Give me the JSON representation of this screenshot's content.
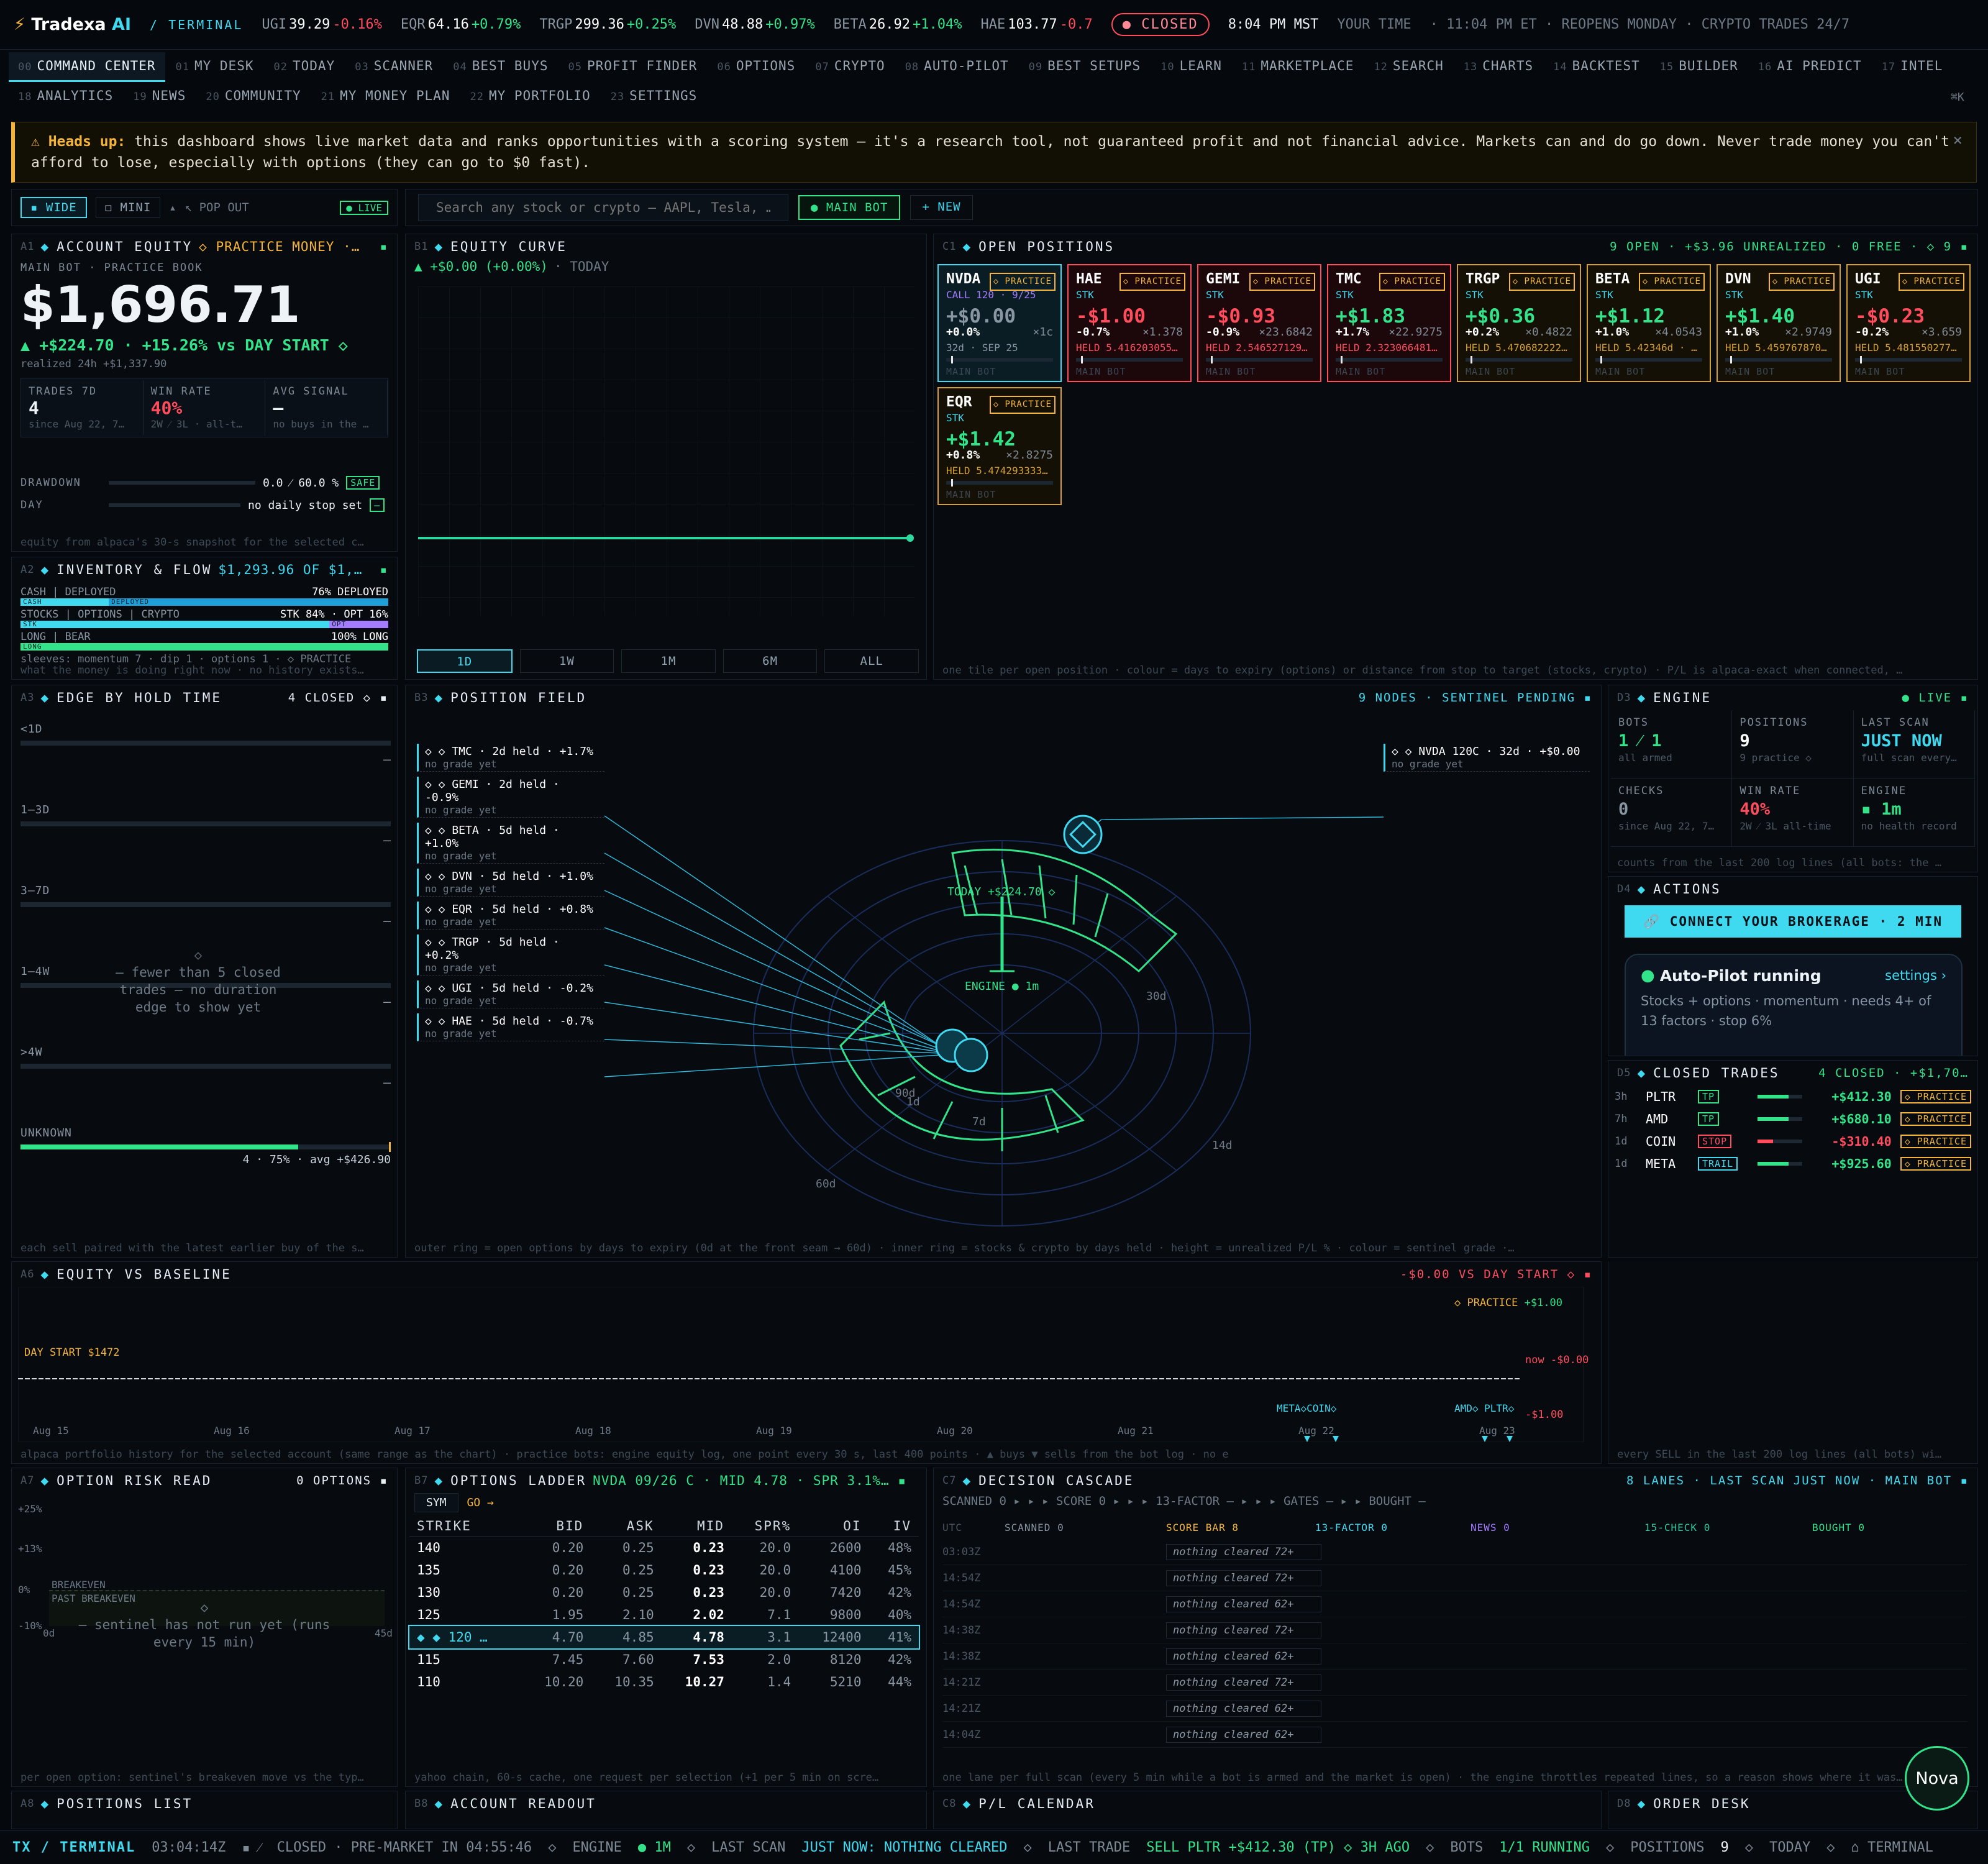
{
  "ticker": {
    "logo": "Tradexa",
    "logo_ai": "AI",
    "sub": "/ TERMINAL",
    "items": [
      {
        "s": "UGI",
        "p": "39.29",
        "c": "-0.16%",
        "up": false
      },
      {
        "s": "EQR",
        "p": "64.16",
        "c": "+0.79%",
        "up": true
      },
      {
        "s": "TRGP",
        "p": "299.36",
        "c": "+0.25%",
        "up": true
      },
      {
        "s": "DVN",
        "p": "48.88",
        "c": "+0.97%",
        "up": true
      },
      {
        "s": "BETA",
        "p": "26.92",
        "c": "+1.04%",
        "up": true
      },
      {
        "s": "HAE",
        "p": "103.77",
        "c": "-0.7",
        "up": false
      }
    ],
    "market": "CLOSED",
    "time": "8:04 PM MST",
    "your": "YOUR TIME",
    "et": "· 11:04 PM ET · REOPENS MONDAY · CRYPTO TRADES 24/7"
  },
  "nav": [
    [
      "00",
      "COMMAND CENTER"
    ],
    [
      "01",
      "MY DESK"
    ],
    [
      "02",
      "TODAY"
    ],
    [
      "03",
      "SCANNER"
    ],
    [
      "04",
      "BEST BUYS"
    ],
    [
      "05",
      "PROFIT FINDER"
    ],
    [
      "06",
      "OPTIONS"
    ],
    [
      "07",
      "CRYPTO"
    ],
    [
      "08",
      "AUTO-PILOT"
    ],
    [
      "09",
      "BEST SETUPS"
    ],
    [
      "10",
      "LEARN"
    ],
    [
      "11",
      "MARKETPLACE"
    ],
    [
      "12",
      "SEARCH"
    ],
    [
      "13",
      "CHARTS"
    ],
    [
      "14",
      "BACKTEST"
    ],
    [
      "15",
      "BUILDER"
    ],
    [
      "16",
      "AI PREDICT"
    ],
    [
      "17",
      "INTEL"
    ],
    [
      "18",
      "ANALYTICS"
    ],
    [
      "19",
      "NEWS"
    ],
    [
      "20",
      "COMMUNITY"
    ],
    [
      "21",
      "MY MONEY PLAN"
    ],
    [
      "22",
      "MY PORTFOLIO"
    ],
    [
      "23",
      "SETTINGS"
    ]
  ],
  "nav_kbd": "⌘K",
  "warn": {
    "head": "Heads up:",
    "text": "this dashboard shows live market data and ranks opportunities with a scoring system — it's a research tool, not guaranteed profit and not financial advice. Markets can and do go down. Never trade money you can't afford to lose, especially with options (they can go to $0 fast).",
    "close": "×"
  },
  "toolbar": {
    "wide": "▪ WIDE",
    "mini": "◻ MINI",
    "pop": "↖ POP OUT",
    "live": "● LIVE",
    "search_ph": "Search any stock or crypto — AAPL, Tesla, …",
    "mainbot": "● MAIN BOT",
    "new": "+ NEW"
  },
  "a1": {
    "id": "A1",
    "title": "ACCOUNT EQUITY",
    "mode": "◇ PRACTICE MONEY ·…",
    "sub": "MAIN BOT · PRACTICE BOOK",
    "equity": "$1,696.71",
    "change": "▲ +$224.70 · +15.26% vs DAY START ◇",
    "realized": "realized 24h +$1,337.90",
    "stats": [
      {
        "l": "TRADES 7D",
        "v": "4",
        "s": "since Aug 22, 7…"
      },
      {
        "l": "WIN RATE",
        "v": "40%",
        "s": "2W ⁄ 3L · all-t…"
      },
      {
        "l": "AVG SIGNAL",
        "v": "—",
        "s": "no buys in the …"
      }
    ],
    "dd_l": "DRAWDOWN",
    "dd_v": "0.0 ⁄ 60.0 %",
    "dd_b": "SAFE",
    "day_l": "DAY",
    "day_v": "no daily stop set",
    "day_b": "—",
    "foot": "equity from alpaca's 30-s snapshot for the selected c…"
  },
  "a2": {
    "id": "A2",
    "title": "INVENTORY & FLOW",
    "rt": "$1,293.96 OF $1,…",
    "rows": [
      {
        "l": "CASH | DEPLOYED",
        "r": "76% DEPLOYED",
        "a": "CASH",
        "b": "DEPLOYED",
        "pct": 0.24
      },
      {
        "l": "STOCKS | OPTIONS | CRYPTO",
        "r": "STK 84% · OPT 16%",
        "a": "STK",
        "b": "OPT",
        "pct": 0.84
      },
      {
        "l": "LONG | BEAR",
        "r": "100% LONG",
        "a": "LONG",
        "b": "",
        "pct": 1.0
      }
    ],
    "sleeves": "sleeves: momentum 7 · dip 1 · options 1 · ◇ PRACTICE",
    "foot": "what the money is doing right now · no history exists…"
  },
  "b1": {
    "id": "B1",
    "title": "EQUITY CURVE",
    "chg": "▲ +$0.00 (+0.00%)",
    "when": "· TODAY",
    "ranges": [
      "1D",
      "1W",
      "1M",
      "6M",
      "ALL"
    ]
  },
  "c1": {
    "id": "C1",
    "title": "OPEN POSITIONS",
    "rt": "9 OPEN · +$3.96 UNREALIZED · 0 FREE · ◇ 9 ▪",
    "tag": "◇ PRACTICE",
    "bot": "MAIN BOT",
    "tiles": [
      {
        "s": "NVDA",
        "k": "CALL 120 · 9/25",
        "v": "+$0.00",
        "p": "+0.0%",
        "q": "×1c",
        "h": "32d · SEP 25",
        "t": "n"
      },
      {
        "s": "HAE",
        "k": "STK",
        "v": "-$1.00",
        "p": "-0.7%",
        "q": "×1.378",
        "h": "HELD 5.416203055…",
        "t": "r"
      },
      {
        "s": "GEMI",
        "k": "STK",
        "v": "-$0.93",
        "p": "-0.9%",
        "q": "×23.6842",
        "h": "HELD 2.546527129…",
        "t": "r"
      },
      {
        "s": "TMC",
        "k": "STK",
        "v": "+$1.83",
        "p": "+1.7%",
        "q": "×22.9275",
        "h": "HELD 2.323066481…",
        "t": "r"
      },
      {
        "s": "TRGP",
        "k": "STK",
        "v": "+$0.36",
        "p": "+0.2%",
        "q": "×0.4822",
        "h": "HELD 5.470682222…",
        "t": "y"
      },
      {
        "s": "BETA",
        "k": "STK",
        "v": "+$1.12",
        "p": "+1.0%",
        "q": "×4.0543",
        "h": "HELD 5.42346d · …",
        "t": "y"
      },
      {
        "s": "DVN",
        "k": "STK",
        "v": "+$1.40",
        "p": "+1.0%",
        "q": "×2.9749",
        "h": "HELD 5.459767870…",
        "t": "y"
      },
      {
        "s": "UGI",
        "k": "STK",
        "v": "-$0.23",
        "p": "-0.2%",
        "q": "×3.659",
        "h": "HELD 5.481550277…",
        "t": "y"
      },
      {
        "s": "EQR",
        "k": "STK",
        "v": "+$1.42",
        "p": "+0.8%",
        "q": "×2.8275",
        "h": "HELD 5.474293333…",
        "t": "y"
      }
    ],
    "foot": "one tile per open position · colour = days to expiry (options) or distance from stop to target (stocks, crypto) · P/L is alpaca-exact when connected, …"
  },
  "a3": {
    "id": "A3",
    "title": "EDGE BY HOLD TIME",
    "rt": "4 CLOSED ◇ ▪",
    "rows": [
      "<1D",
      "1–3D",
      "3–7D",
      "1–4W",
      ">4W",
      "UNKNOWN"
    ],
    "empty": "— fewer than 5 closed trades — no duration edge to show yet",
    "unk": "4 · 75% · avg +$426.90",
    "foot": "each sell paired with the latest earlier buy of the s…"
  },
  "b3": {
    "id": "B3",
    "title": "POSITION FIELD",
    "rt": "9 NODES · SENTINEL PENDING ▪",
    "labels": [
      {
        "t": "◇ ◇ TMC · 2d held · +1.7%",
        "g": "no grade yet"
      },
      {
        "t": "◇ ◇ GEMI · 2d held · -0.9%",
        "g": "no grade yet"
      },
      {
        "t": "◇ ◇ BETA · 5d held · +1.0%",
        "g": "no grade yet"
      },
      {
        "t": "◇ ◇ DVN · 5d held · +1.0%",
        "g": "no grade yet"
      },
      {
        "t": "◇ ◇ EQR · 5d held · +0.8%",
        "g": "no grade yet"
      },
      {
        "t": "◇ ◇ TRGP · 5d held · +0.2%",
        "g": "no grade yet"
      },
      {
        "t": "◇ ◇ UGI · 5d held · -0.2%",
        "g": "no grade yet"
      },
      {
        "t": "◇ ◇ HAE · 5d held · -0.7%",
        "g": "no grade yet"
      }
    ],
    "opt": {
      "t": "◇ ◇ NVDA 120C · 32d · +$0.00",
      "g": "no grade yet"
    },
    "today": "TODAY +$224.70 ◇",
    "engine": "ENGINE ● 1m",
    "rings": [
      "30d",
      "14d",
      "7d",
      "1d",
      "90d",
      "60d"
    ],
    "foot": "outer ring = open options by days to expiry (0d at the front seam → 60d) · inner ring = stocks & crypto by days held · height = unrealized P/L % · colour = sentinel grade ·…"
  },
  "d3": {
    "id": "D3",
    "title": "ENGINE",
    "rt": "● LIVE ▪",
    "cells": [
      {
        "l": "BOTS",
        "v": "1 ⁄ 1",
        "s": "all armed"
      },
      {
        "l": "POSITIONS",
        "v": "9",
        "s": "9 practice ◇"
      },
      {
        "l": "LAST SCAN",
        "v": "JUST NOW",
        "s": "full scan every…"
      },
      {
        "l": "CHECKS",
        "v": "0",
        "s": "since Aug 22, 7…"
      },
      {
        "l": "WIN RATE",
        "v": "40%",
        "s": "2W ⁄ 3L all-time"
      },
      {
        "l": "ENGINE",
        "v": "▪ 1m",
        "s": "no health record"
      }
    ],
    "foot": "counts from the last 200 log lines (all bots: the …"
  },
  "d4": {
    "id": "D4",
    "title": "ACTIONS",
    "connect": "🔗 CONNECT YOUR BROKERAGE · 2 MIN",
    "ap_title": "Auto-Pilot running",
    "ap_settings": "settings ›",
    "ap_desc": "Stocks + options · momentum · needs 4+ of 13 factors · stop 6%"
  },
  "d5": {
    "id": "D5",
    "title": "CLOSED TRADES",
    "rt": "4 CLOSED · +$1,70…",
    "tag": "◇ PRACTICE",
    "rows": [
      {
        "ago": "3h",
        "s": "PLTR",
        "b": "TP",
        "v": "+$412.30",
        "up": true
      },
      {
        "ago": "7h",
        "s": "AMD",
        "b": "TP",
        "v": "+$680.10",
        "up": true
      },
      {
        "ago": "1d",
        "s": "COIN",
        "b": "STOP",
        "v": "-$310.40",
        "up": false
      },
      {
        "ago": "1d",
        "s": "META",
        "b": "TRAIL",
        "v": "+$925.60",
        "up": true
      }
    ]
  },
  "a6": {
    "id": "A6",
    "title": "EQUITY VS BASELINE",
    "rt": "-$0.00 VS DAY START ◇ ▪",
    "practice": "◇ PRACTICE",
    "top": "+$1.00",
    "bot": "-$1.00",
    "now": "now -$0.00",
    "daystart": "DAY START $1472",
    "dates": [
      "Aug 15",
      "Aug 16",
      "Aug 17",
      "Aug 18",
      "Aug 19",
      "Aug 20",
      "Aug 21",
      "Aug 22",
      "Aug 23"
    ],
    "ev1": "META◇COIN◇",
    "ev2": "AMD◇ PLTR◇",
    "foot": "alpaca portfolio history for the selected account (same range as the chart) · practice bots: engine equity log, one point every 30 s, last 400 points · ▲ buys ▼ sells from the bot log · no exposure history exists — this is the hone…",
    "foot2": "every SELL in the last 200 log lines (all bots) wi…"
  },
  "a7": {
    "id": "A7",
    "title": "OPTION RISK READ",
    "rt": "0 OPTIONS ▪",
    "ticks": [
      "+25%",
      "+13%",
      "0%",
      "-10%"
    ],
    "be": "BREAKEVEN",
    "pbe": "PAST BREAKEVEN",
    "x0": "0d",
    "x1": "45d",
    "msg": "— sentinel has not run yet (runs every 15 min)",
    "foot": "per open option: sentinel's breakeven move vs the typ…"
  },
  "b7": {
    "id": "B7",
    "title": "OPTIONS LADDER",
    "rt": "NVDA 09/26 C · MID 4.78 · SPR 3.1%… ▪",
    "sym": "SYM",
    "go": "GO →",
    "cols": [
      "STRIKE",
      "BID",
      "ASK",
      "MID",
      "SPR%",
      "OI",
      "IV"
    ],
    "rows": [
      [
        "140",
        "0.20",
        "0.25",
        "0.23",
        "20.0",
        "2600",
        "48%"
      ],
      [
        "135",
        "0.20",
        "0.25",
        "0.23",
        "20.0",
        "4100",
        "45%"
      ],
      [
        "130",
        "0.20",
        "0.25",
        "0.23",
        "20.0",
        "7420",
        "42%"
      ],
      [
        "125",
        "1.95",
        "2.10",
        "2.02",
        "7.1",
        "9800",
        "40%"
      ],
      [
        "◆ ◆ 120 …",
        "4.70",
        "4.85",
        "4.78",
        "3.1",
        "12400",
        "41%"
      ],
      [
        "115",
        "7.45",
        "7.60",
        "7.53",
        "2.0",
        "8120",
        "42%"
      ],
      [
        "110",
        "10.20",
        "10.35",
        "10.27",
        "1.4",
        "5210",
        "44%"
      ]
    ],
    "foot": "yahoo chain, 60-s cache, one request per selection (+1 per 5 min on scre…"
  },
  "c7": {
    "id": "C7",
    "title": "DECISION CASCADE",
    "rt": "8 LANES · LAST SCAN JUST NOW · MAIN BOT ▪",
    "flow": "SCANNED 0 ▸ ▸ ▸ SCORE 0 ▸ ▸ ▸ 13-FACTOR — ▸ ▸ ▸ GATES — ▸ ▸ BOUGHT —",
    "cols": [
      "UTC",
      "SCANNED 0",
      "SCORE BAR 8",
      "13-FACTOR 0",
      "NEWS 0",
      "15-CHECK 0",
      "BOUGHT 0"
    ],
    "rows": [
      [
        "03:03Z",
        "nothing cleared 72+"
      ],
      [
        "14:54Z",
        "nothing cleared 72+"
      ],
      [
        "14:54Z",
        "nothing cleared 62+"
      ],
      [
        "14:38Z",
        "nothing cleared 72+"
      ],
      [
        "14:38Z",
        "nothing cleared 62+"
      ],
      [
        "14:21Z",
        "nothing cleared 72+"
      ],
      [
        "14:21Z",
        "nothing cleared 62+"
      ],
      [
        "14:04Z",
        "nothing cleared 62+"
      ]
    ],
    "foot": "one lane per full scan (every 5 min while a bot is armed and the market is open) · the engine throttles repeated lines, so a reason shows where it was…"
  },
  "bottom": [
    {
      "id": "A8",
      "t": "POSITIONS LIST"
    },
    {
      "id": "B8",
      "t": "ACCOUNT READOUT"
    },
    {
      "id": "C8",
      "t": "P/L CALENDAR"
    },
    {
      "id": "D8",
      "t": "ORDER DESK"
    }
  ],
  "nova": "Nova",
  "status": {
    "brand": "TX / TERMINAL",
    "clock": "03:04:14Z",
    "market": "CLOSED · PRE-MARKET IN 04:55:46",
    "engine_l": "ENGINE",
    "engine_v": "● 1M",
    "scan_l": "LAST SCAN",
    "scan_v": "JUST NOW: NOTHING CLEARED",
    "trade_l": "LAST TRADE",
    "trade_v": "SELL PLTR +$412.30 (TP) ◇ 3H AGO",
    "bots_l": "BOTS",
    "bots_v": "1/1 RUNNING",
    "pos_l": "POSITIONS",
    "pos_v": "9",
    "today": "TODAY",
    "term": "⌂ TERMINAL"
  },
  "colors": {
    "accent": "#3fd9f0",
    "up": "#32e38a",
    "down": "#ff4d5e",
    "warn": "#f4b43b"
  }
}
